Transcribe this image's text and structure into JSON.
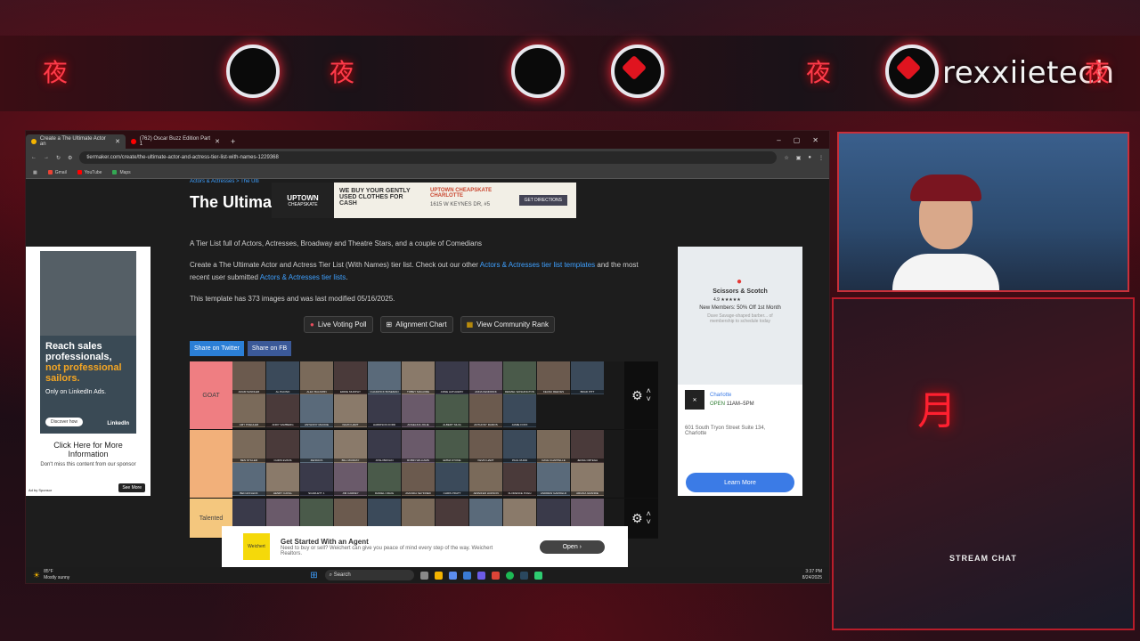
{
  "overlay": {
    "brand": "rexxiietech",
    "brand_kanji": "夜",
    "kanji_left": "夜",
    "kanji_mid": "夜",
    "kanji_mid2": "夜",
    "chat_label": "STREAM CHAT",
    "moon_kanji": "月",
    "accent_color": "#e0141f"
  },
  "browser": {
    "tabs": [
      {
        "label": "Create a The Ultimate Actor an",
        "active": true
      },
      {
        "label": "(762) Oscar Buzz Edition Part 1",
        "active": false
      }
    ],
    "new_tab": "+",
    "window_controls": [
      "–",
      "▢",
      "✕"
    ],
    "url": "tiermaker.com/create/the-ultimate-actor-and-actress-tier-list-with-names-1229368",
    "bookmarks": [
      "Gmail",
      "YouTube",
      "Maps"
    ]
  },
  "page": {
    "breadcrumb": "Actors & Actresses > The Ulti",
    "title": "The Ultimate Actor and Actress Tier List Maker",
    "tagline": "A Tier List full of Actors, Actresses, Broadway and Theatre Stars, and a couple of Comedians",
    "desc_pre": "Create a The Ultimate Actor and Actress Tier List (With Names) tier list. Check out our other",
    "desc_link1": "Actors & Actresses tier list templates",
    "desc_mid": "and the most recent user submitted",
    "desc_link2": "Actors & Actresses tier lists",
    "desc_post": ".",
    "stats": "This template has 373 images and was last modified 05/16/2025.",
    "buttons": [
      "Live Voting Poll",
      "Alignment Chart",
      "View Community Rank"
    ],
    "share_twitter": "Share on Twitter",
    "share_fb": "Share on FB",
    "tiers": [
      {
        "label": "GOAT",
        "color": "#ef7e82"
      },
      {
        "label": "",
        "color": "#f2b07a"
      },
      {
        "label": "Talented",
        "color": "#f4c77e"
      }
    ],
    "tier_cells": [
      "ADAM SANDLER",
      "AL PACINO",
      "ALEC BALDWIN",
      "EDDIE MURPHY",
      "CHADWICK BOSEMAN",
      "TOBEY MAGUIRE",
      "ANNE HATHAWAY",
      "ANNA KENDRICK",
      "DENZEL WASHINGTON",
      "KEANU REEVES",
      "BRAD PITT",
      "AMY POEHLER",
      "ANDY SAMBERG",
      "ANTHONY MACKIE",
      "KEVIN HART",
      "HARRISON FORD",
      "ANGELINA JOLIE",
      "ALBERT SILVA",
      "ANTHONY RAMOS",
      "JAMIE FOXX",
      "BEN STILLER",
      "CHRIS EVANS",
      "ZENDAYA",
      "BILL MURRAY",
      "JOSH BROLIN",
      "ROBIN WILLIAMS",
      "EMMA STONE",
      "KEVIN HART",
      "PAUL RUDD",
      "DAVE CHAPPELLE",
      "JENNA ORTEGA",
      "BEN AFFLECK",
      "HENRY CAVILL",
      "SCARLETT J.",
      "JIM CARREY",
      "DANIEL CRAIG",
      "AMANDA SEYFRIED",
      "CHRIS PRATT",
      "JENNIFER HUDSON",
      "FLORENCE PUGH",
      "ANDREW GARFIELD",
      "ARIANA GRANDE",
      "BRYAN CRANSTON",
      "EMMA WATSON",
      "ZOE SALDANA",
      "WILL SMITH",
      "HALLE BERRY",
      "FOREST WHITAKER",
      "BRADLEY COOPER",
      "MARGOT ROBBIE",
      "WILL FERRELL",
      "TIMOTHEE C.",
      "JENNIFER LAWRENCE"
    ]
  },
  "ads": {
    "top_brand": "UPTOWN",
    "top_brand_sub": "CHEAPSKATE",
    "top_text": "WE BUY YOUR GENTLY USED CLOTHES FOR CASH",
    "top_place": "UPTOWN CHEAPSKATE CHARLOTTE",
    "top_address": "1615 W KEYNES DR, #5",
    "top_cta": "GET DIRECTIONS",
    "left_line1": "Reach sales professionals,",
    "left_line2": "not professional sailors.",
    "left_line3": "Only on LinkedIn Ads.",
    "left_btn": "Discover how",
    "left_brand": "LinkedIn",
    "left_cta_title": "Click Here for More Information",
    "left_cta_sub": "Don't miss this content from our sponsor",
    "left_sponsor": "Ad by Sponsor",
    "left_see_more": "See More",
    "right_map_title": "Scissors & Scotch",
    "right_map_rating": "4.9 ★★★★★",
    "right_map_text": "New Members: 50% Off 1st Month",
    "right_map_sub": "Dave Savage-shaped barber... of membership to schedule today",
    "right_city": "Charlotte",
    "right_open": "OPEN",
    "right_hours": "11AM–5PM",
    "right_address": "601 South Tryon Street Suite 134, Charlotte",
    "right_cta": "Learn More",
    "bottom_brand": "Weichert",
    "bottom_title": "Get Started With an Agent",
    "bottom_text": "Need to buy or sell? Weichert can give you peace of mind every step of the way. Weichert Realtors.",
    "bottom_cta": "Open"
  },
  "taskbar": {
    "weather_temp": "85°F",
    "weather_desc": "Mostly sunny",
    "search_placeholder": "Search",
    "time": "3:37 PM",
    "date": "8/24/2025"
  }
}
